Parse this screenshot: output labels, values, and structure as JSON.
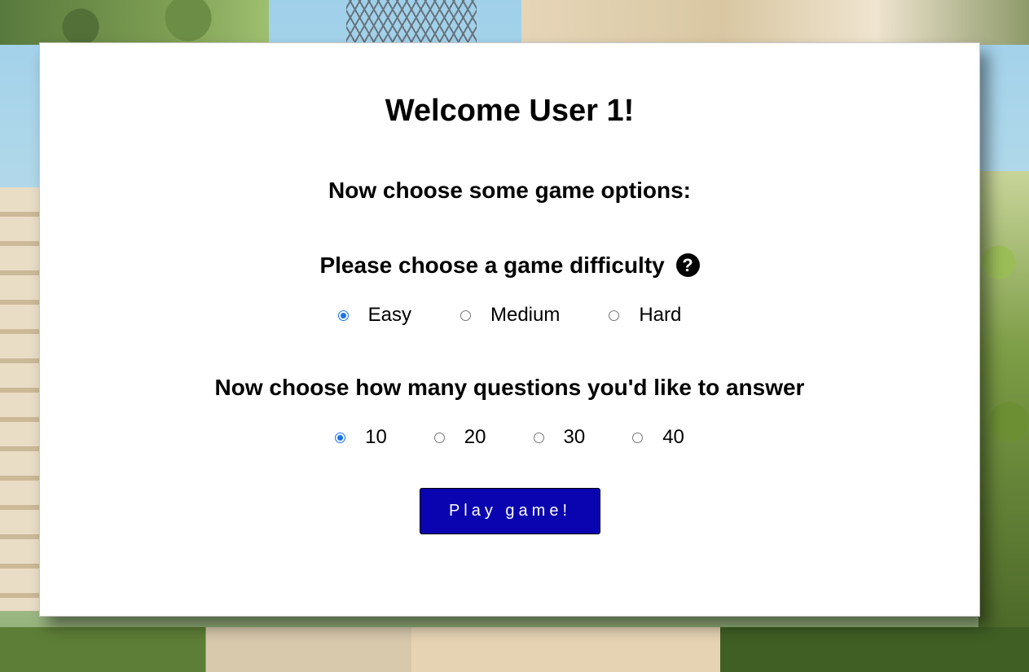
{
  "page": {
    "title": "Welcome User 1!",
    "subtitle": "Now choose some game options:"
  },
  "difficulty": {
    "heading": "Please choose a game difficulty",
    "help_icon": "question-circle-icon",
    "options": [
      {
        "label": "Easy",
        "checked": true
      },
      {
        "label": "Medium",
        "checked": false
      },
      {
        "label": "Hard",
        "checked": false
      }
    ]
  },
  "questions": {
    "heading": "Now choose how many questions you'd like to answer",
    "options": [
      {
        "label": "10",
        "checked": true
      },
      {
        "label": "20",
        "checked": false
      },
      {
        "label": "30",
        "checked": false
      },
      {
        "label": "40",
        "checked": false
      }
    ]
  },
  "play_button": {
    "label": "Play game!",
    "color": "#0a04b0"
  },
  "colors": {
    "radio_accent": "#1a73e8",
    "card_background": "#ffffff"
  }
}
